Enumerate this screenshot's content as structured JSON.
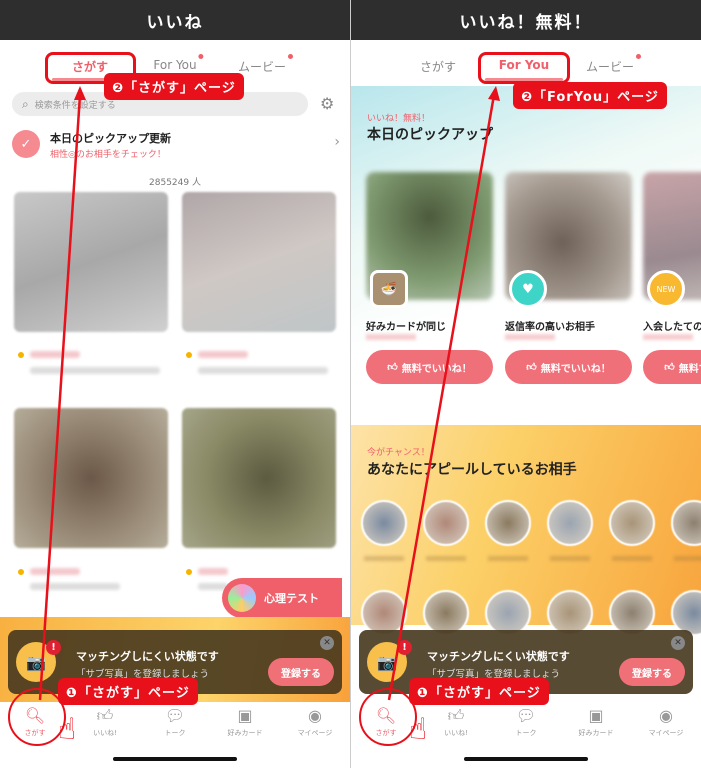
{
  "left": {
    "header_title": "いいね",
    "tabs": [
      {
        "label": "さがす",
        "active": true
      },
      {
        "label": "For You",
        "badge": true
      },
      {
        "label": "ムービー",
        "badge": true
      }
    ],
    "search_placeholder": "検索条件を設定する",
    "pickup": {
      "title": "本日のピックアップ更新",
      "subtitle": "相性◎のお相手をチェック！"
    },
    "member_count": "2855249 人",
    "test_button": "心理テスト"
  },
  "right": {
    "header_title": "いいね！無料！",
    "tabs": [
      {
        "label": "さがす"
      },
      {
        "label": "For You",
        "active": true
      },
      {
        "label": "ムービー",
        "badge": true
      }
    ],
    "pickup_section": {
      "kicker": "いいね！無料！",
      "title": "本日のピックアップ",
      "cards": [
        {
          "label": "好みカードが同じ",
          "badge": "food-photo"
        },
        {
          "label": "返信率の高いお相手",
          "badge": "heart-chat-icon"
        },
        {
          "label": "入会したての",
          "badge": "new-icon"
        }
      ],
      "like_button": "無料でいいね！"
    },
    "appeal_section": {
      "kicker": "今がチャンス！",
      "title": "あなたにアピールしているお相手"
    }
  },
  "notice": {
    "title": "マッチングしにくい状態です",
    "body": "「サブ写真」を登録しましょう",
    "register": "登録する"
  },
  "tabbar": [
    {
      "label": "さがす",
      "icon": "search-icon"
    },
    {
      "label": "いいね!",
      "icon": "thumbs-up-icon"
    },
    {
      "label": "トーク",
      "icon": "chat-icon"
    },
    {
      "label": "好みカード",
      "icon": "card-icon"
    },
    {
      "label": "マイページ",
      "icon": "user-icon"
    }
  ],
  "annotations": {
    "left_step1": "❶「さがす」ページ",
    "left_step2": "❷「さがす」ページ",
    "right_step1": "❶「さがす」ページ",
    "right_step2": "❷「ForYou」ページ"
  },
  "colors": {
    "accent": "#f0606a",
    "annotation": "#e8101a",
    "header": "#2e2e2e"
  }
}
